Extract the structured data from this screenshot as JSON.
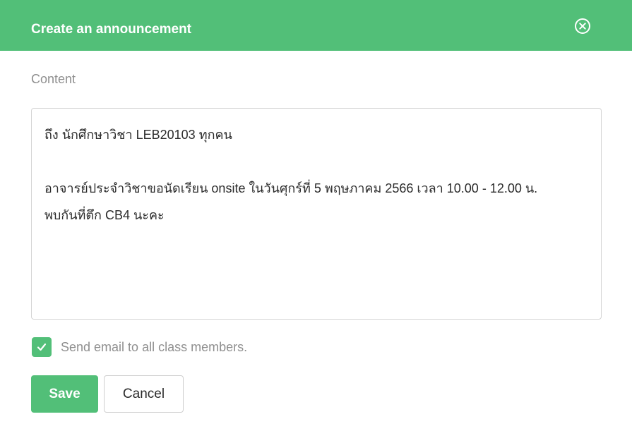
{
  "modal": {
    "title": "Create an announcement",
    "close_icon": "close-circle-icon"
  },
  "form": {
    "content_label": "Content",
    "content_lines": [
      "ถึง นักศึกษาวิชา LEB20103 ทุกคน",
      "",
      "อาจารย์ประจำวิชาขอนัดเรียน onsite ในวันศุกร์ที่ 5 พฤษภาคม 2566 เวลา 10.00 - 12.00 น.",
      "พบกันที่ตึก CB4 นะคะ"
    ],
    "send_email": {
      "checked": true,
      "label": "Send email to all class members."
    }
  },
  "actions": {
    "save_label": "Save",
    "cancel_label": "Cancel"
  },
  "colors": {
    "accent": "#52bf78",
    "muted_text": "#8f8f8f",
    "body_text": "#2b2b2b",
    "border": "#d4d4d4"
  }
}
